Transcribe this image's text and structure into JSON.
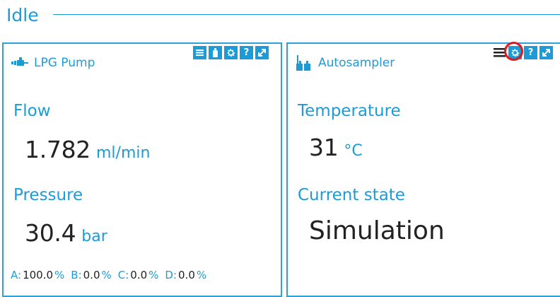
{
  "section": {
    "title": "Idle"
  },
  "pump": {
    "name": "LPG Pump",
    "flow_label": "Flow",
    "flow_value": "1.782",
    "flow_unit": "ml/min",
    "pressure_label": "Pressure",
    "pressure_value": "30.4",
    "pressure_unit": "bar",
    "composition": [
      {
        "key": "A:",
        "value": "100.0",
        "unit": "%"
      },
      {
        "key": "B:",
        "value": "0.0",
        "unit": "%"
      },
      {
        "key": "C:",
        "value": "0.0",
        "unit": "%"
      },
      {
        "key": "D:",
        "value": "0.0",
        "unit": "%"
      }
    ],
    "toolbar": [
      "menu-icon",
      "bottle-icon",
      "gear-icon",
      "help-icon",
      "expand-icon"
    ],
    "icon": "pump-icon"
  },
  "autosampler": {
    "name": "Autosampler",
    "temp_label": "Temperature",
    "temp_value": "31",
    "temp_unit": "°C",
    "state_label": "Current state",
    "state_value": "Simulation",
    "toolbar": [
      "menu-icon",
      "gear-icon",
      "help-icon",
      "expand-icon"
    ],
    "highlighted_tool": "gear-icon",
    "icon": "autosampler-icon"
  },
  "colors": {
    "accent": "#1d9bd7",
    "highlight": "#e5151e",
    "text": "#222222"
  },
  "help_glyph": "?"
}
